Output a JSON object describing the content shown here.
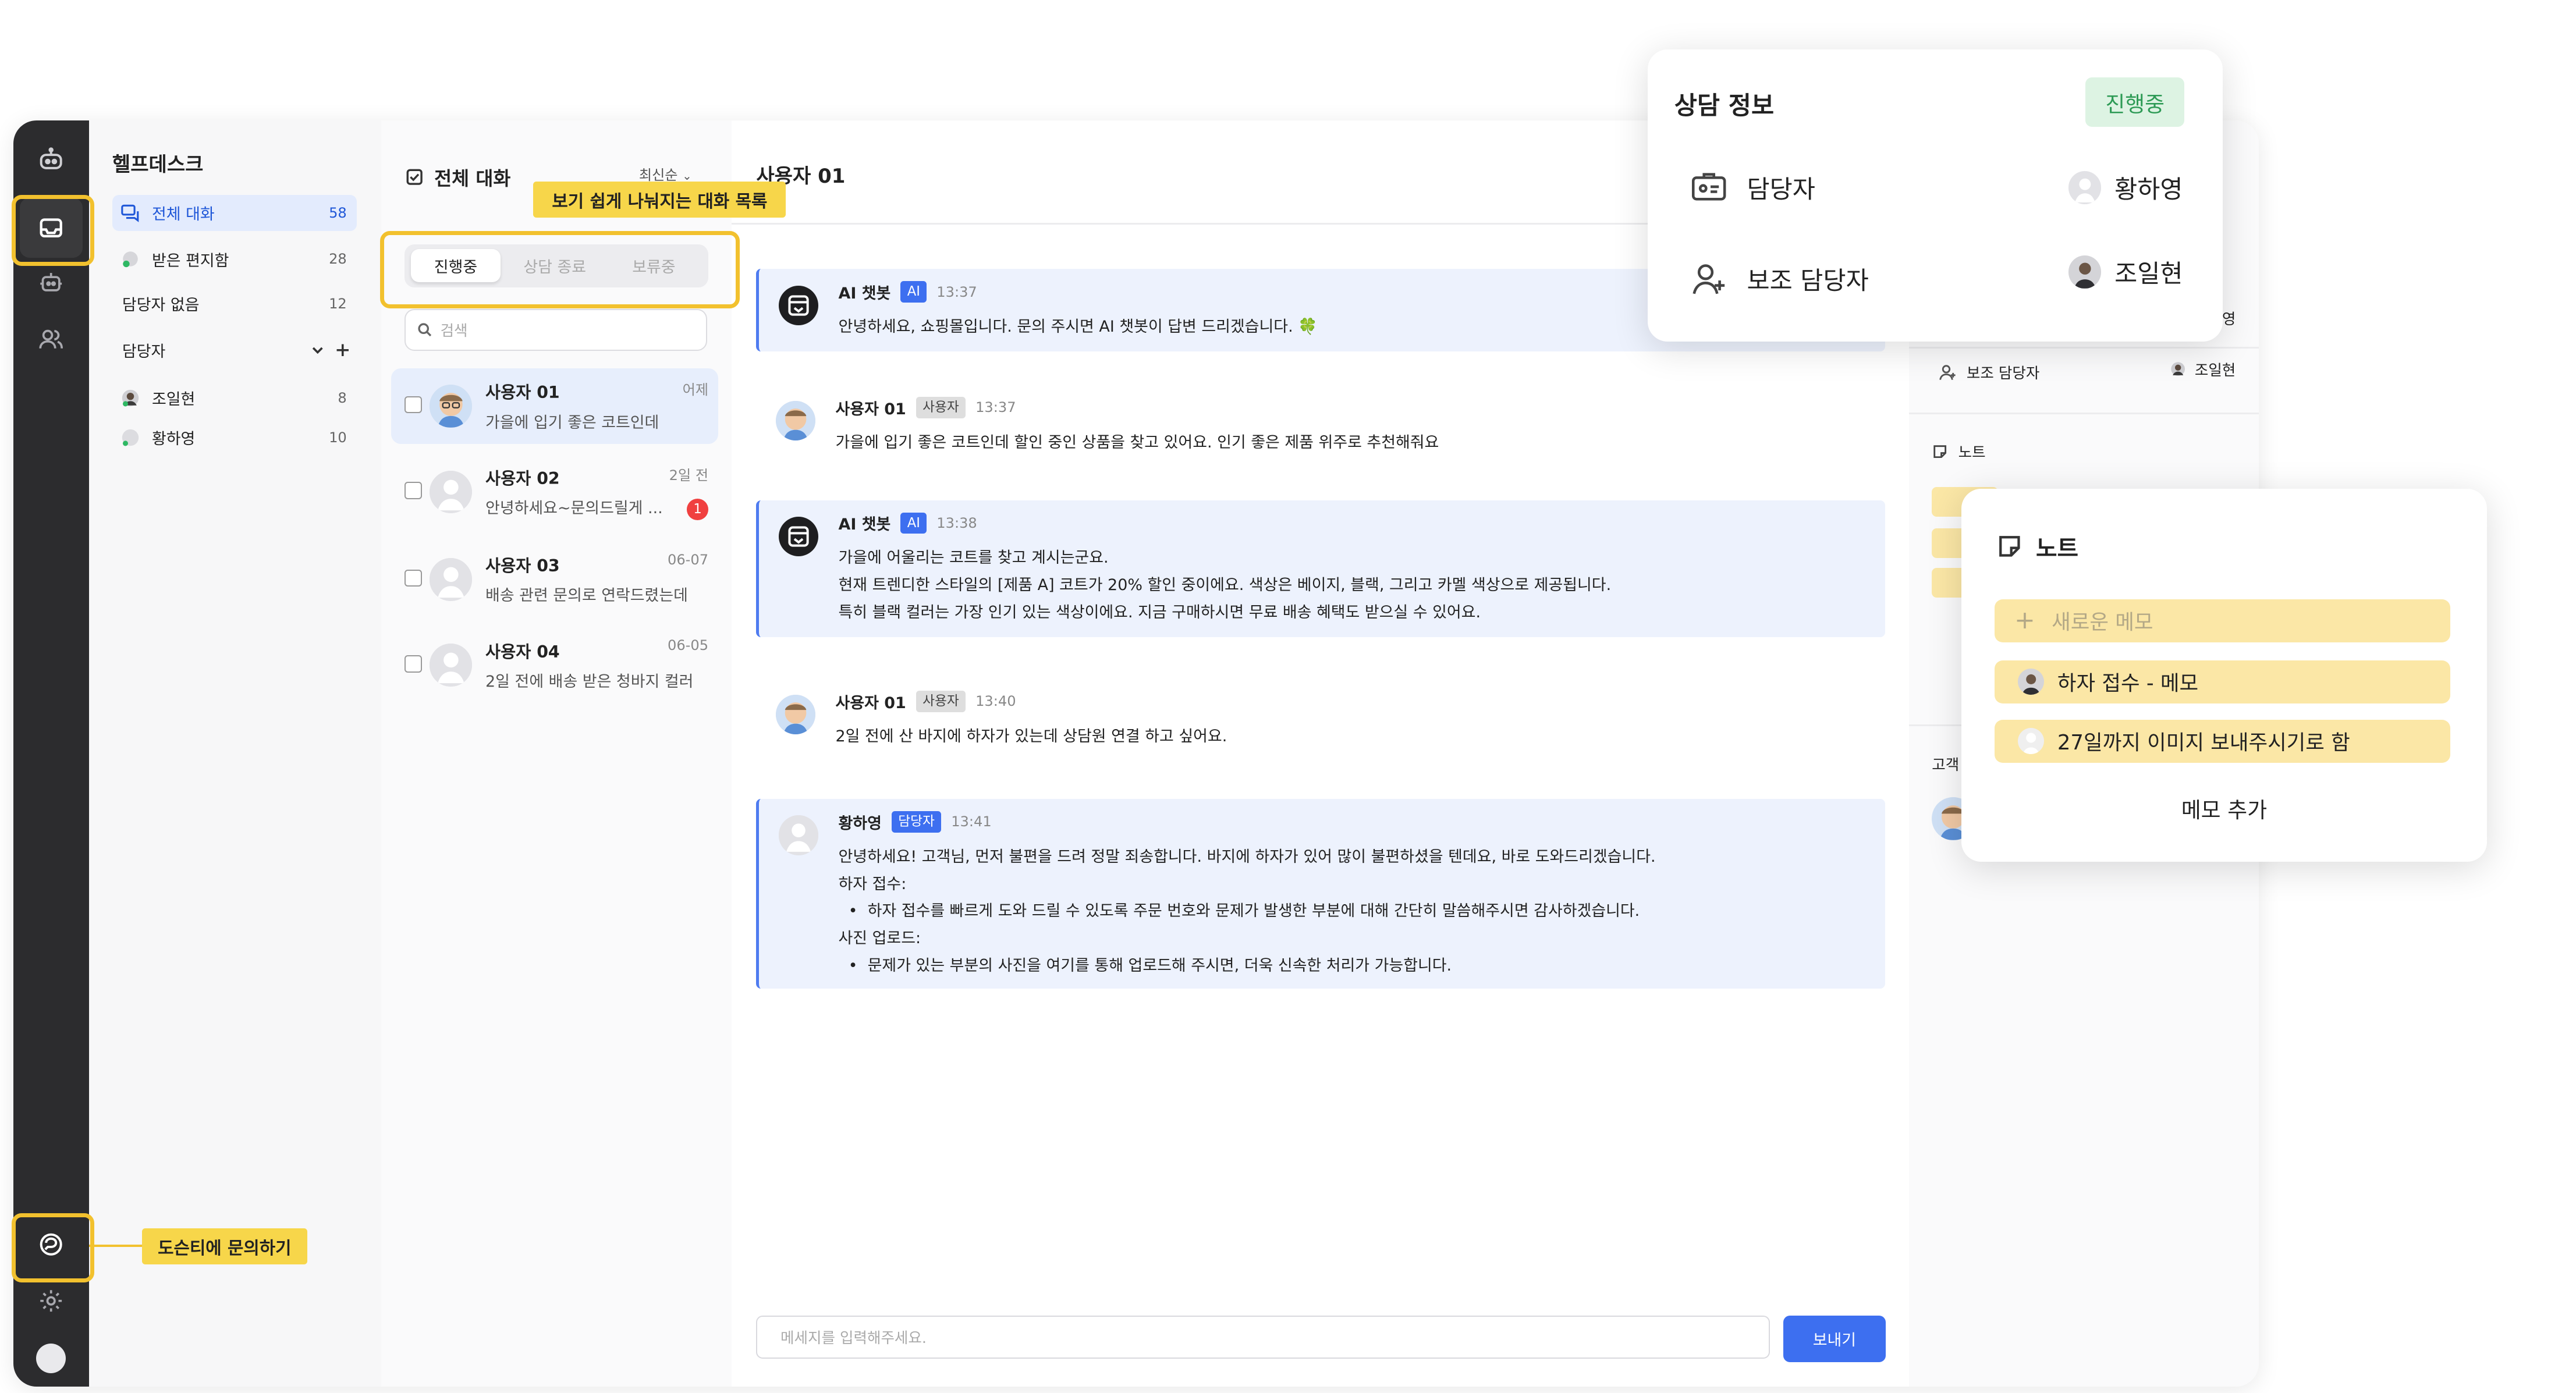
{
  "sidebar": {
    "title": "헬프데스크",
    "items": [
      {
        "label": "전체 대화",
        "count": "58"
      },
      {
        "label": "받은 편지함",
        "count": "28"
      },
      {
        "label": "담당자 없음",
        "count": "12"
      },
      {
        "label": "담당자"
      },
      {
        "label": "조일현",
        "count": "8"
      },
      {
        "label": "황하영",
        "count": "10"
      }
    ]
  },
  "conversations": {
    "title": "전체 대화",
    "sort": "최신순",
    "tabs": [
      "진행중",
      "상담 종료",
      "보류중"
    ],
    "search_placeholder": "검색",
    "items": [
      {
        "name": "사용자 01",
        "preview": "가을에 입기 좋은 코트인데",
        "time": "어제"
      },
      {
        "name": "사용자 02",
        "preview": "안녕하세요~문의드릴게 ...",
        "time": "2일 전",
        "unread": "1"
      },
      {
        "name": "사용자 03",
        "preview": "배송 관련 문의로 연락드렸는데",
        "time": "06-07"
      },
      {
        "name": "사용자 04",
        "preview": "2일 전에 배송 받은 청바지 컬러",
        "time": "06-05"
      }
    ]
  },
  "chat": {
    "title": "사용자 01",
    "messages": [
      {
        "sender": "AI 챗봇",
        "tag": "AI",
        "time": "13:37",
        "body": "안녕하세요, 쇼핑몰입니다. 문의 주시면 AI 챗봇이 답변 드리겠습니다. 🍀"
      },
      {
        "sender": "사용자 01",
        "tag": "사용자",
        "time": "13:37",
        "body": "가을에 입기 좋은 코트인데 할인 중인 상품을 찾고 있어요. 인기 좋은 제품 위주로 추천해줘요"
      },
      {
        "sender": "AI 챗봇",
        "tag": "AI",
        "time": "13:38",
        "body": "가을에 어울리는 코트를 찾고 계시는군요.\n현재 트렌디한 스타일의 [제품 A] 코트가 20% 할인 중이에요. 색상은 베이지, 블랙, 그리고 카멜 색상으로 제공됩니다.\n특히 블랙 컬러는 가장 인기 있는 색상이에요. 지금 구매하시면 무료 배송 혜택도 받으실 수 있어요."
      },
      {
        "sender": "사용자 01",
        "tag": "사용자",
        "time": "13:40",
        "body": "2일 전에 산 바지에 하자가 있는데 상담원 연결 하고 싶어요."
      },
      {
        "sender": "황하영",
        "tag": "담당자",
        "time": "13:41",
        "body": "안녕하세요! 고객님, 먼저 불편을 드려 정말 죄송합니다. 바지에 하자가 있어 많이 불편하셨을 텐데요, 바로 도와드리겠습니다.\n하자 접수:\n  •  하자 접수를 빠르게 도와 드릴 수 있도록 주문 번호와 문제가 발생한 부분에 대해 간단히 말씀해주시면 감사하겠습니다.\n사진 업로드:\n  •  문제가 있는 부분의 사진을 여기를 통해 업로드해 주시면, 더욱 신속한 처리가 가능합니다."
      }
    ],
    "composer_placeholder": "메세지를 입력해주세요.",
    "send_label": "보내기"
  },
  "right_panel": {
    "peek_1": "영",
    "sub_assignee_label": "보조 담당자",
    "sub_assignee_name": "조일현",
    "note_label": "노트",
    "customer_label": "고객"
  },
  "callouts": {
    "tabs_caption": "보기 쉽게 나눠지는 대화 목록",
    "inquiry_caption": "도슨티에 문의하기"
  },
  "consult_popup": {
    "title": "상담 정보",
    "status": "진행중",
    "assignee_label": "담당자",
    "assignee_name": "황하영",
    "sub_label": "보조 담당자",
    "sub_name": "조일현"
  },
  "note_popup": {
    "title": "노트",
    "new_memo": "새로운 메모",
    "memos": [
      "하자 접수 - 메모",
      "27일까지 이미지 보내주시기로 함"
    ],
    "add_memo": "메모 추가"
  },
  "colors": {
    "accent": "#3d6ff0",
    "highlight": "#f2c12e",
    "rail": "#2c2c2e",
    "note": "#fbe7a6",
    "status_green": "#2d9a55"
  }
}
